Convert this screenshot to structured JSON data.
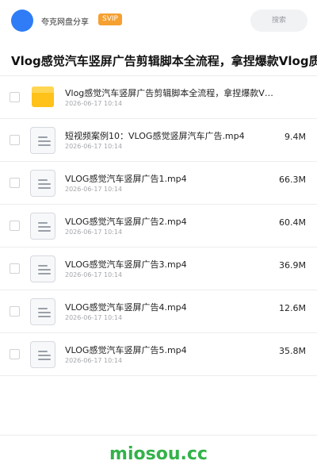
{
  "header": {
    "user_name": "夸克网盘分享",
    "badge": "SVIP",
    "search_label": "搜索",
    "avatar_color": "#2f7cf6",
    "badge_color": "#f5a031"
  },
  "page_title": "Vlog感觉汽车竖屏广告剪辑脚本全流程，拿捏爆款Vlog质感",
  "files": [
    {
      "icon": "folder-icon",
      "name": "Vlog感觉汽车竖屏广告剪辑脚本全流程，拿捏爆款V…",
      "date": "2026-06-17 10:14",
      "size": ""
    },
    {
      "icon": "document-icon",
      "name": "短视频案例10：VLOG感觉竖屏汽车广告.mp4",
      "date": "2026-06-17 10:14",
      "size": "9.4M"
    },
    {
      "icon": "document-icon",
      "name": "VLOG感觉汽车竖屏广告1.mp4",
      "date": "2026-06-17 10:14",
      "size": "66.3M"
    },
    {
      "icon": "document-icon",
      "name": "VLOG感觉汽车竖屏广告2.mp4",
      "date": "2026-06-17 10:14",
      "size": "60.4M"
    },
    {
      "icon": "document-icon",
      "name": "VLOG感觉汽车竖屏广告3.mp4",
      "date": "2026-06-17 10:14",
      "size": "36.9M"
    },
    {
      "icon": "document-icon",
      "name": "VLOG感觉汽车竖屏广告4.mp4",
      "date": "2026-06-17 10:14",
      "size": "12.6M"
    },
    {
      "icon": "document-icon",
      "name": "VLOG感觉汽车竖屏广告5.mp4",
      "date": "2026-06-17 10:14",
      "size": "35.8M"
    }
  ],
  "footer": {
    "brand": "miosou.cc",
    "brand_color": "#33b24a"
  }
}
